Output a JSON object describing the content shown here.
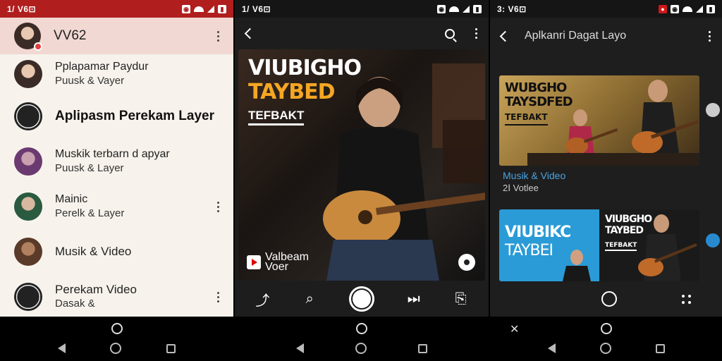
{
  "panel1": {
    "status": {
      "time": "1/ V6⊡"
    },
    "header": {
      "title": "VV62"
    },
    "items": [
      {
        "line1": "Pplapamar Paydur",
        "line2": "Puusk & Vayer"
      },
      {
        "line1": "Aplipasm Perekam Layer",
        "line2": ""
      },
      {
        "line1": "Muskik terbarn d apyar",
        "line2": "Puusk & Layer"
      },
      {
        "line1": "Mainic",
        "line2": "Perelk & Layer"
      },
      {
        "line1": "Musik & Video",
        "line2": ""
      },
      {
        "line1": "Perekam Video",
        "line2": "Dasak &"
      }
    ]
  },
  "panel2": {
    "status": {
      "time": "1/ V6⊡"
    },
    "video": {
      "title_line1": "VIUBIGHO",
      "title_line2": "TAYBED",
      "title_line3": "TEFBAKT",
      "logo_text_1": "Valbeam",
      "logo_text_2": "Voer"
    }
  },
  "panel3": {
    "status": {
      "time": "3: V6⊡"
    },
    "header": {
      "title": "Aplkanri Dagat Layo"
    },
    "card1": {
      "title_line1": "WUBGHO",
      "title_line2": "TAYSDFED",
      "title_line3": "TEFBAKT",
      "meta_line1": "Musik & Video",
      "meta_line2": "2Ⅰ Votlee"
    },
    "card2": {
      "left_line1": "VIUBIKC",
      "left_line2": "TAYBEI",
      "right_line1": "VIUBGHO",
      "right_line2": "TAYBED",
      "right_line3": "TEFBAKT"
    }
  },
  "colors": {
    "status_red": "#b01e1e",
    "header_pink": "#f1d8d2",
    "accent_blue": "#4aa3e0",
    "title_orange": "#f5a623"
  }
}
